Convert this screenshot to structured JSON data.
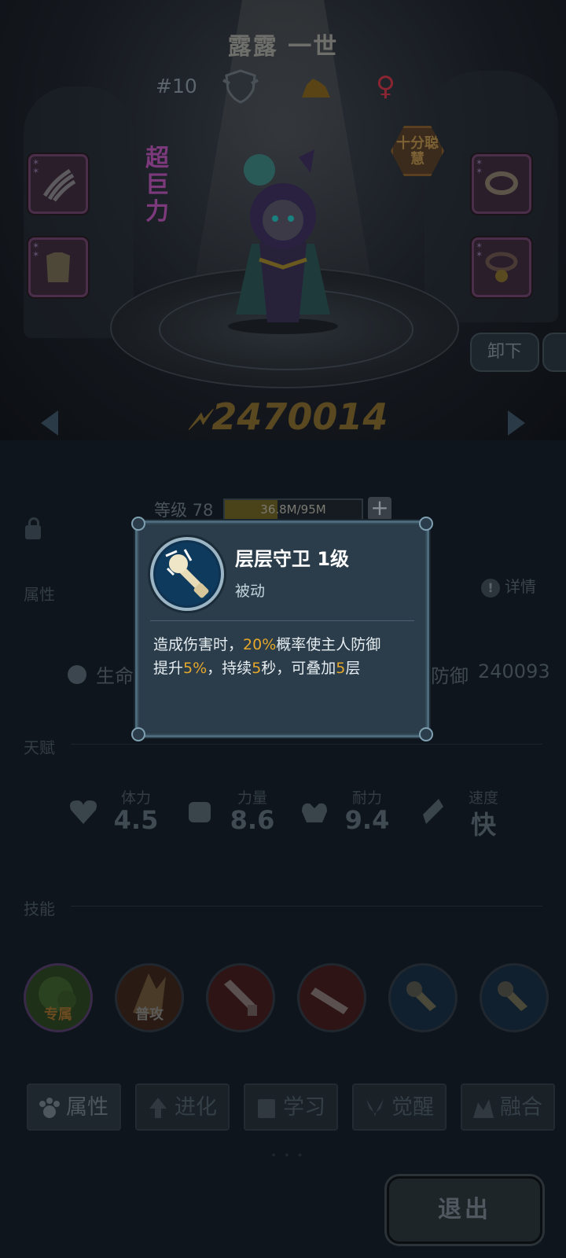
{
  "hero": {
    "name": "露露 一世",
    "rank": "#10",
    "super_tag": "超巨力",
    "wisdom_tag": "十分聪慧",
    "unequip_label": "卸下",
    "power": "2470014"
  },
  "level": {
    "label": "等级 78",
    "xp_text": "36.8M/95M",
    "xp_fraction": 0.387
  },
  "sections": {
    "attributes": "属性",
    "talent": "天赋",
    "skills": "技能",
    "detail": "详情"
  },
  "stats": {
    "life_label": "生命",
    "defense_label": "防御",
    "defense_value": "240093"
  },
  "talents": [
    {
      "label": "体力",
      "value": "4.5",
      "icon": "heart-icon"
    },
    {
      "label": "力量",
      "value": "8.6",
      "icon": "fist-icon"
    },
    {
      "label": "耐力",
      "value": "9.4",
      "icon": "muscle-icon"
    },
    {
      "label": "速度",
      "value": "快",
      "icon": "wing-icon"
    }
  ],
  "skills": [
    {
      "label": "专属",
      "icon": "exclusive-skill-icon"
    },
    {
      "label": "普攻",
      "icon": "normal-attack-icon"
    },
    {
      "label": "",
      "icon": "sword-icon"
    },
    {
      "label": "",
      "icon": "sword-icon"
    },
    {
      "label": "",
      "icon": "guard-skill-icon"
    },
    {
      "label": "",
      "icon": "guard-skill-icon"
    }
  ],
  "tabs": [
    {
      "label": "属性",
      "icon": "paw-icon"
    },
    {
      "label": "进化",
      "icon": "up-arrow-icon"
    },
    {
      "label": "学习",
      "icon": "book-icon"
    },
    {
      "label": "觉醒",
      "icon": "horn-icon"
    },
    {
      "label": "融合",
      "icon": "fusion-icon"
    }
  ],
  "exit_label": "退出",
  "popup": {
    "title": "层层守卫 1级",
    "type": "被动",
    "desc_1": "造成伤害时，",
    "desc_pct1": "20%",
    "desc_2": "概率使主人防御",
    "desc_3": "提升",
    "desc_pct2": "5%",
    "desc_4": "，持续",
    "desc_sec": "5",
    "desc_5": "秒，可叠加",
    "desc_layers": "5",
    "desc_6": "层"
  },
  "colors": {
    "popup_bg": "#2b3d4a",
    "highlight": "#e6a82b",
    "power_gold": "#5a4820"
  }
}
